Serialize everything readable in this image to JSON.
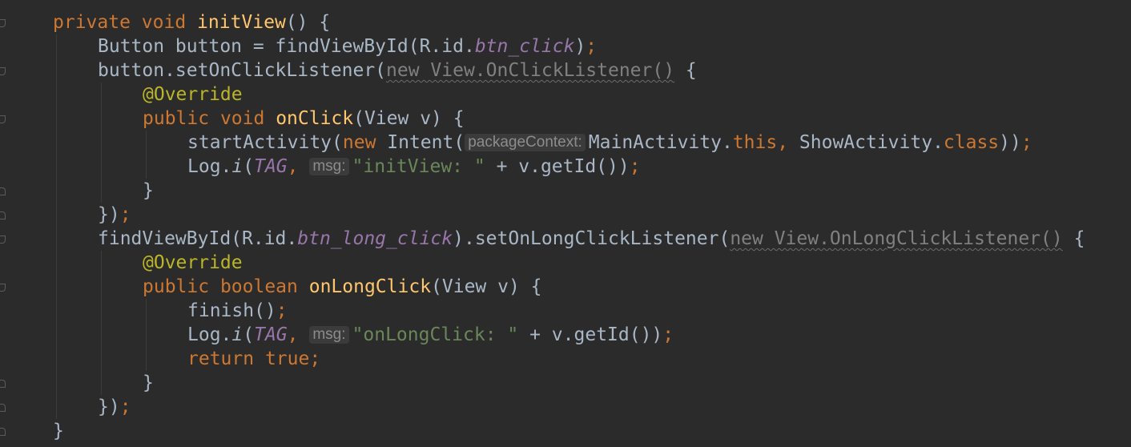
{
  "editor": {
    "lines": [
      {
        "indent": 0,
        "tokens": [
          {
            "t": "private ",
            "c": "kw"
          },
          {
            "t": "void ",
            "c": "kw"
          },
          {
            "t": "initView",
            "c": "fn"
          },
          {
            "t": "() {",
            "c": ""
          }
        ]
      },
      {
        "indent": 1,
        "tokens": [
          {
            "t": "Button button = findViewById(R.id.",
            "c": ""
          },
          {
            "t": "btn_click",
            "c": "fld"
          },
          {
            "t": ")",
            "c": ""
          },
          {
            "t": ";",
            "c": "kw"
          }
        ]
      },
      {
        "indent": 1,
        "tokens": [
          {
            "t": "button.setOnClickListener(",
            "c": ""
          },
          {
            "t": "new View.OnClickListener()",
            "c": "anon"
          },
          {
            "t": " {",
            "c": ""
          }
        ]
      },
      {
        "indent": 2,
        "tokens": [
          {
            "t": "@Override",
            "c": "ann"
          }
        ]
      },
      {
        "indent": 2,
        "tokens": [
          {
            "t": "public ",
            "c": "kw"
          },
          {
            "t": "void ",
            "c": "kw"
          },
          {
            "t": "onClick",
            "c": "fn"
          },
          {
            "t": "(View v) {",
            "c": ""
          }
        ]
      },
      {
        "indent": 3,
        "tokens": [
          {
            "t": "startActivity(",
            "c": ""
          },
          {
            "t": "new ",
            "c": "kw"
          },
          {
            "t": "Intent(",
            "c": ""
          },
          {
            "t": "packageContext:",
            "c": "hint"
          },
          {
            "t": "MainActivity.",
            "c": ""
          },
          {
            "t": "this",
            "c": "kw"
          },
          {
            "t": ", ",
            "c": "kw"
          },
          {
            "t": "ShowActivity.",
            "c": ""
          },
          {
            "t": "class",
            "c": "kw"
          },
          {
            "t": "))",
            "c": ""
          },
          {
            "t": ";",
            "c": "kw"
          }
        ]
      },
      {
        "indent": 3,
        "tokens": [
          {
            "t": "Log.",
            "c": ""
          },
          {
            "t": "i",
            "c": "it"
          },
          {
            "t": "(",
            "c": ""
          },
          {
            "t": "TAG",
            "c": "fld"
          },
          {
            "t": ", ",
            "c": "kw"
          },
          {
            "t": "msg:",
            "c": "hint"
          },
          {
            "t": "\"initView: \"",
            "c": "str"
          },
          {
            "t": " + v.getId())",
            "c": ""
          },
          {
            "t": ";",
            "c": "kw"
          }
        ]
      },
      {
        "indent": 2,
        "tokens": [
          {
            "t": "}",
            "c": ""
          }
        ]
      },
      {
        "indent": 1,
        "tokens": [
          {
            "t": "})",
            "c": ""
          },
          {
            "t": ";",
            "c": "kw"
          }
        ]
      },
      {
        "indent": 1,
        "tokens": [
          {
            "t": "findViewById(R.id.",
            "c": ""
          },
          {
            "t": "btn_long_click",
            "c": "fld"
          },
          {
            "t": ").setOnLongClickListener(",
            "c": ""
          },
          {
            "t": "new View.OnLongClickListener()",
            "c": "anon"
          },
          {
            "t": " {",
            "c": ""
          }
        ]
      },
      {
        "indent": 2,
        "tokens": [
          {
            "t": "@Override",
            "c": "ann"
          }
        ]
      },
      {
        "indent": 2,
        "tokens": [
          {
            "t": "public ",
            "c": "kw"
          },
          {
            "t": "boolean ",
            "c": "kw"
          },
          {
            "t": "onLongClick",
            "c": "fn"
          },
          {
            "t": "(View v) {",
            "c": ""
          }
        ]
      },
      {
        "indent": 3,
        "tokens": [
          {
            "t": "finish()",
            "c": ""
          },
          {
            "t": ";",
            "c": "kw"
          }
        ]
      },
      {
        "indent": 3,
        "tokens": [
          {
            "t": "Log.",
            "c": ""
          },
          {
            "t": "i",
            "c": "it"
          },
          {
            "t": "(",
            "c": ""
          },
          {
            "t": "TAG",
            "c": "fld"
          },
          {
            "t": ", ",
            "c": "kw"
          },
          {
            "t": "msg:",
            "c": "hint"
          },
          {
            "t": "\"onLongClick: \"",
            "c": "str"
          },
          {
            "t": " + v.getId())",
            "c": ""
          },
          {
            "t": ";",
            "c": "kw"
          }
        ]
      },
      {
        "indent": 3,
        "tokens": [
          {
            "t": "return ",
            "c": "kw"
          },
          {
            "t": "true",
            "c": "kw"
          },
          {
            "t": ";",
            "c": "kw"
          }
        ]
      },
      {
        "indent": 2,
        "tokens": [
          {
            "t": "}",
            "c": ""
          }
        ]
      },
      {
        "indent": 1,
        "tokens": [
          {
            "t": "})",
            "c": ""
          },
          {
            "t": ";",
            "c": "kw"
          }
        ]
      },
      {
        "indent": 0,
        "tokens": [
          {
            "t": "}",
            "c": ""
          }
        ]
      }
    ]
  },
  "colors": {
    "background": "#2b2b2b",
    "default_text": "#a9b7c6",
    "keyword": "#cc7832",
    "method_declaration": "#ffc66d",
    "annotation": "#bbb529",
    "field": "#9876aa",
    "string": "#6a8759",
    "parameter_hint": "#8c8c8c"
  }
}
